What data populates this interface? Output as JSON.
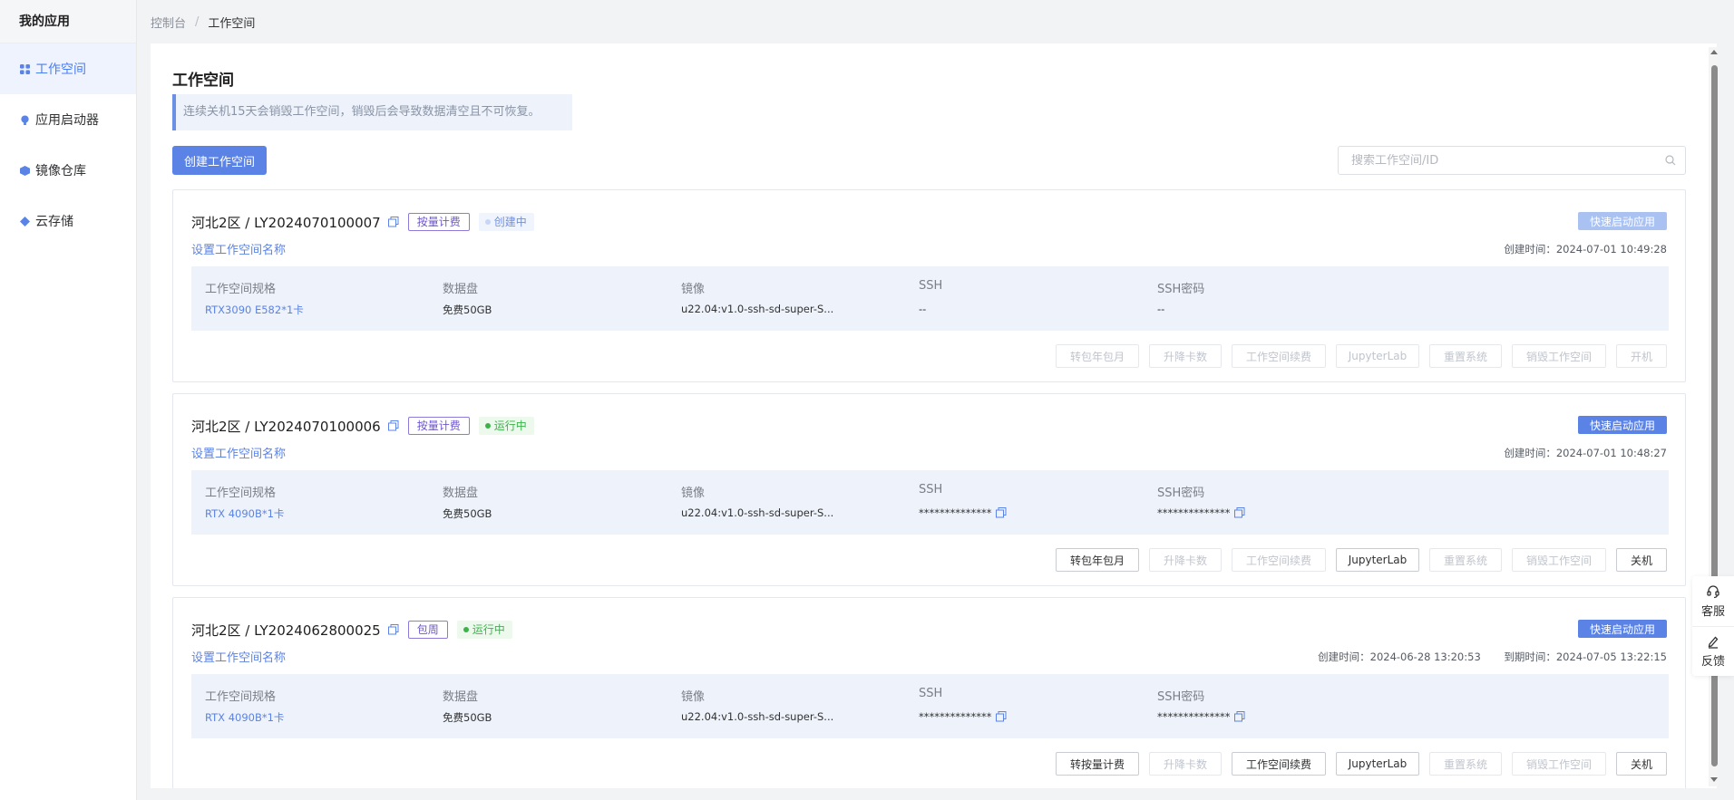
{
  "sidebar": {
    "title": "我的应用",
    "items": [
      {
        "label": "工作空间",
        "icon": "workspace-icon",
        "active": true
      },
      {
        "label": "应用启动器",
        "icon": "launcher-icon",
        "active": false
      },
      {
        "label": "镜像仓库",
        "icon": "image-repo-icon",
        "active": false
      },
      {
        "label": "云存储",
        "icon": "cloud-storage-icon",
        "active": false
      }
    ]
  },
  "breadcrumb": {
    "root": "控制台",
    "separator": "/",
    "current": "工作空间"
  },
  "page": {
    "title": "工作空间",
    "notice": "连续关机15天会销毁工作空间，销毁后会导致数据清空且不可恢复。",
    "create_button": "创建工作空间",
    "search_placeholder": "搜索工作空间/ID"
  },
  "columns": {
    "spec": "工作空间规格",
    "disk": "数据盘",
    "image": "镜像",
    "ssh": "SSH",
    "ssh_password": "SSH密码"
  },
  "set_name_label": "设置工作空间名称",
  "quick_launch_label": "快速启动应用",
  "workspaces": [
    {
      "title": "河北2区 / LY2024070100007",
      "billing": "按量计费",
      "status": "创建中",
      "quick_launch_enabled": false,
      "created": "创建时间：2024-07-01 10:49:28",
      "spec": "RTX3090 E582*1卡",
      "disk": "免费50GB",
      "image": "u22.04:v1.0-ssh-sd-super-S...",
      "ssh": "--",
      "ssh_password": "--",
      "actions": [
        {
          "label": "转包年包月",
          "enabled": false
        },
        {
          "label": "升降卡数",
          "enabled": false
        },
        {
          "label": "工作空间续费",
          "enabled": false
        },
        {
          "label": "JupyterLab",
          "enabled": false
        },
        {
          "label": "重置系统",
          "enabled": false
        },
        {
          "label": "销毁工作空间",
          "enabled": false
        },
        {
          "label": "开机",
          "enabled": false
        }
      ]
    },
    {
      "title": "河北2区 / LY2024070100006",
      "billing": "按量计费",
      "status": "运行中",
      "quick_launch_enabled": true,
      "created": "创建时间：2024-07-01 10:48:27",
      "spec": "RTX 4090B*1卡",
      "disk": "免费50GB",
      "image": "u22.04:v1.0-ssh-sd-super-S...",
      "ssh": "**************",
      "ssh_password": "**************",
      "actions": [
        {
          "label": "转包年包月",
          "enabled": true
        },
        {
          "label": "升降卡数",
          "enabled": false
        },
        {
          "label": "工作空间续费",
          "enabled": false
        },
        {
          "label": "JupyterLab",
          "enabled": true
        },
        {
          "label": "重置系统",
          "enabled": false
        },
        {
          "label": "销毁工作空间",
          "enabled": false
        },
        {
          "label": "关机",
          "enabled": true
        }
      ]
    },
    {
      "title": "河北2区 / LY2024062800025",
      "billing": "包周",
      "status": "运行中",
      "quick_launch_enabled": true,
      "created": "创建时间：2024-06-28 13:20:53",
      "expires": "到期时间：2024-07-05 13:22:15",
      "spec": "RTX 4090B*1卡",
      "disk": "免费50GB",
      "image": "u22.04:v1.0-ssh-sd-super-S...",
      "ssh": "**************",
      "ssh_password": "**************",
      "actions": [
        {
          "label": "转按量计费",
          "enabled": true
        },
        {
          "label": "升降卡数",
          "enabled": false
        },
        {
          "label": "工作空间续费",
          "enabled": true
        },
        {
          "label": "JupyterLab",
          "enabled": true
        },
        {
          "label": "重置系统",
          "enabled": false
        },
        {
          "label": "销毁工作空间",
          "enabled": false
        },
        {
          "label": "关机",
          "enabled": true
        }
      ]
    }
  ],
  "float_widget": [
    {
      "label": "客服",
      "icon": "headset-icon"
    },
    {
      "label": "反馈",
      "icon": "edit-icon"
    }
  ],
  "colors": {
    "accent": "#5b83e6",
    "running": "#3bb34a",
    "billing_tag": "#6e56cf"
  }
}
